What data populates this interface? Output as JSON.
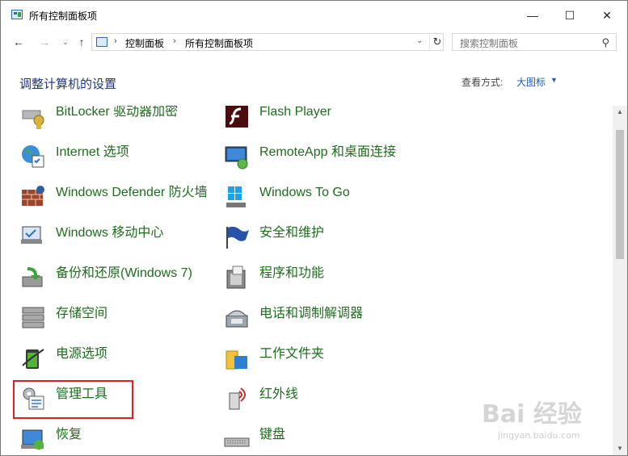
{
  "window": {
    "title": "所有控制面板项",
    "buttons": {
      "minimize": "—",
      "maximize": "☐",
      "close": "✕"
    }
  },
  "nav": {
    "back": "←",
    "forward": "→",
    "recent": "⌄",
    "up": "↑",
    "breadcrumb": [
      "控制面板",
      "所有控制面板项"
    ],
    "search_placeholder": "搜索控制面板"
  },
  "header": {
    "title": "调整计算机的设置",
    "view_by_label": "查看方式:",
    "view_by_value": "大图标"
  },
  "items": [
    {
      "label": "BitLocker 驱动器加密",
      "icon": "bitlocker-icon"
    },
    {
      "label": "Flash Player",
      "icon": "flash-icon"
    },
    {
      "label": "Internet 选项",
      "icon": "internet-options-icon"
    },
    {
      "label": "RemoteApp 和桌面连接",
      "icon": "remoteapp-icon"
    },
    {
      "label": "Windows Defender 防火墙",
      "icon": "firewall-icon"
    },
    {
      "label": "Windows To Go",
      "icon": "windows-to-go-icon"
    },
    {
      "label": "Windows 移动中心",
      "icon": "mobility-center-icon"
    },
    {
      "label": "安全和维护",
      "icon": "security-flag-icon"
    },
    {
      "label": "备份和还原(Windows 7)",
      "icon": "backup-icon"
    },
    {
      "label": "程序和功能",
      "icon": "programs-icon"
    },
    {
      "label": "存储空间",
      "icon": "storage-icon"
    },
    {
      "label": "电话和调制解调器",
      "icon": "phone-modem-icon"
    },
    {
      "label": "电源选项",
      "icon": "power-icon"
    },
    {
      "label": "工作文件夹",
      "icon": "work-folders-icon"
    },
    {
      "label": "管理工具",
      "icon": "admin-tools-icon"
    },
    {
      "label": "红外线",
      "icon": "infrared-icon"
    },
    {
      "label": "恢复",
      "icon": "recovery-icon"
    },
    {
      "label": "键盘",
      "icon": "keyboard-icon"
    }
  ],
  "watermark": {
    "main": "Bai 经验",
    "sub": "jingyan.baidu.com"
  }
}
